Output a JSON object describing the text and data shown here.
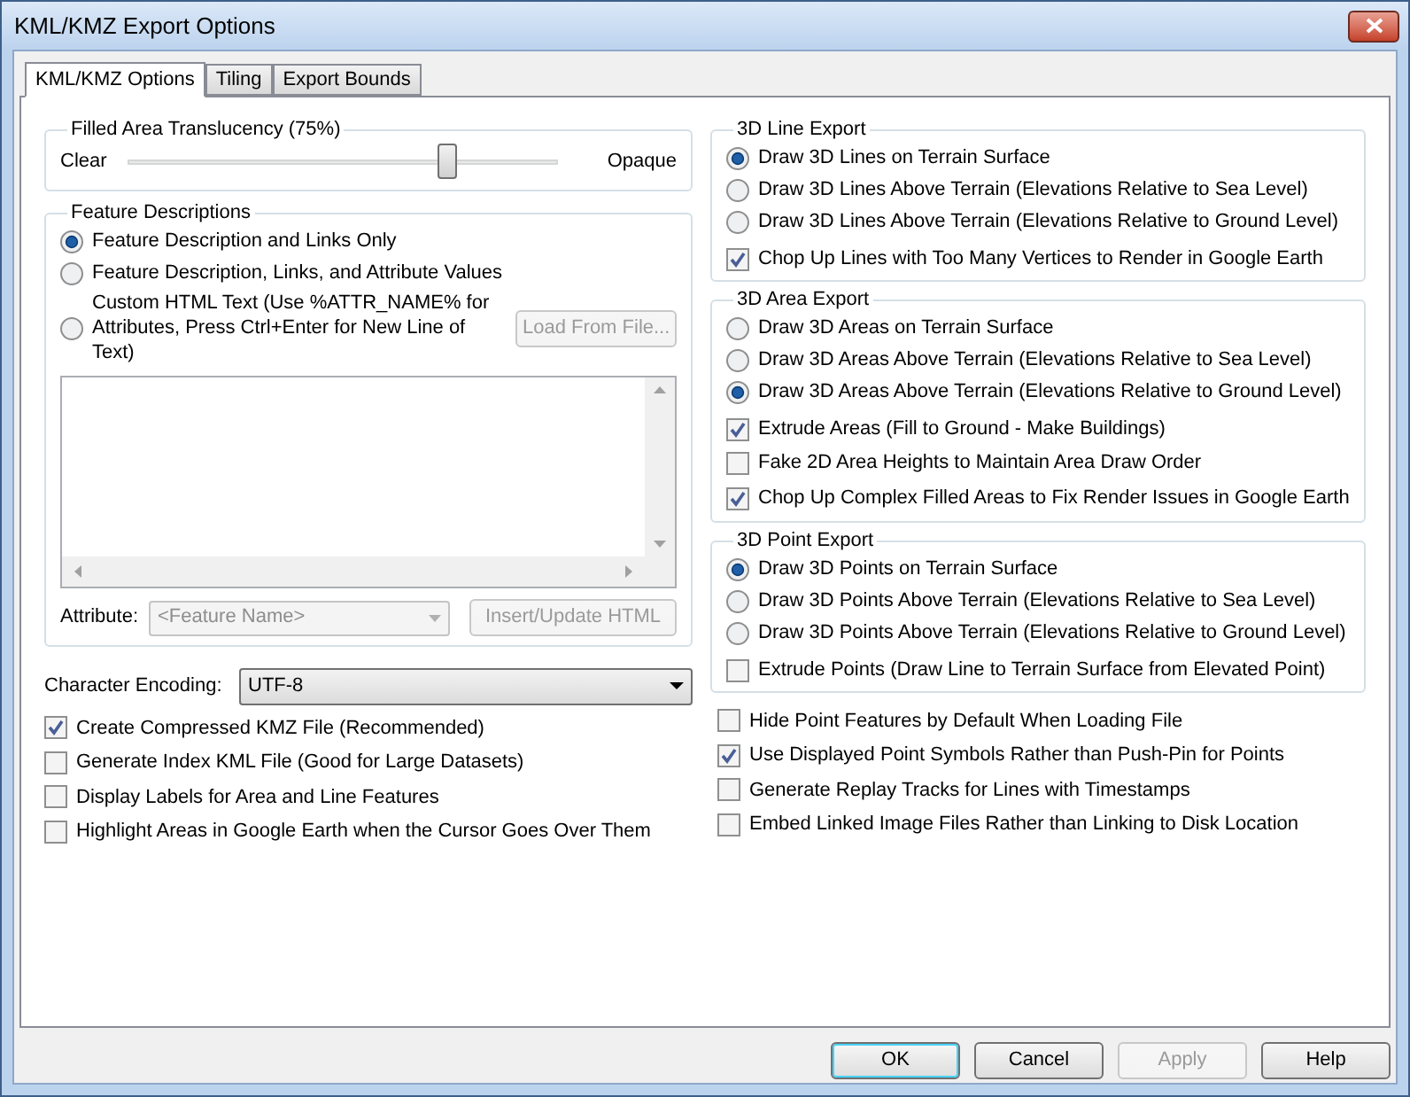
{
  "window": {
    "title": "KML/KMZ Export Options"
  },
  "tabs": [
    {
      "label": "KML/KMZ Options",
      "selected": true
    },
    {
      "label": "Tiling",
      "selected": false
    },
    {
      "label": "Export Bounds",
      "selected": false
    }
  ],
  "translucency": {
    "title": "Filled Area Translucency (75%)",
    "min_label": "Clear",
    "max_label": "Opaque",
    "level": 0.74
  },
  "feature_descriptions": {
    "title": "Feature Descriptions",
    "options": [
      {
        "label": "Feature Description and Links Only",
        "selected": true
      },
      {
        "label": "Feature Description, Links, and Attribute Values",
        "selected": false
      },
      {
        "label": "Custom HTML Text (Use %ATTR_NAME% for Attributes, Press Ctrl+Enter for New Line of Text)",
        "selected": false
      }
    ],
    "load_button": {
      "label": "Load From File...",
      "disabled": true
    },
    "attribute_label": "Attribute:",
    "attribute_select": {
      "value": "<Feature Name>",
      "disabled": true
    },
    "insert_button": {
      "label": "Insert/Update HTML",
      "disabled": true
    }
  },
  "character_encoding": {
    "label": "Character Encoding:",
    "value": "UTF-8"
  },
  "left_options": [
    {
      "label": "Create Compressed KMZ File (Recommended)",
      "checked": true
    },
    {
      "label": "Generate Index KML File (Good for Large Datasets)",
      "checked": false
    },
    {
      "label": "Display Labels for Area and Line Features",
      "checked": false
    },
    {
      "label": "Highlight Areas in Google Earth when the Cursor Goes Over Them",
      "checked": false
    }
  ],
  "groups": [
    {
      "title": "3D Line Export",
      "items": [
        {
          "kind": "radio",
          "label": "Draw 3D Lines on Terrain Surface",
          "selected": true
        },
        {
          "kind": "radio",
          "label": "Draw 3D Lines Above Terrain (Elevations Relative to Sea Level)",
          "selected": false
        },
        {
          "kind": "radio",
          "label": "Draw 3D Lines Above Terrain (Elevations Relative to Ground Level)",
          "selected": false
        },
        {
          "kind": "checkbox",
          "label": "Chop Up Lines with Too Many Vertices to Render in Google Earth",
          "checked": true
        }
      ]
    },
    {
      "title": "3D Area Export",
      "items": [
        {
          "kind": "radio",
          "label": "Draw 3D Areas on Terrain Surface",
          "selected": false
        },
        {
          "kind": "radio",
          "label": "Draw 3D Areas Above Terrain (Elevations Relative to Sea Level)",
          "selected": false
        },
        {
          "kind": "radio",
          "label": "Draw 3D Areas Above Terrain (Elevations Relative to Ground Level)",
          "selected": true
        },
        {
          "kind": "checkbox",
          "label": "Extrude Areas (Fill to Ground - Make Buildings)",
          "checked": true
        },
        {
          "kind": "checkbox",
          "label": "Fake 2D Area Heights to Maintain Area Draw Order",
          "checked": false
        },
        {
          "kind": "checkbox",
          "label": "Chop Up Complex Filled Areas to Fix Render Issues in Google Earth",
          "checked": true
        }
      ]
    },
    {
      "title": "3D Point Export",
      "items": [
        {
          "kind": "radio",
          "label": "Draw 3D Points on Terrain Surface",
          "selected": true
        },
        {
          "kind": "radio",
          "label": "Draw 3D Points Above Terrain (Elevations Relative to Sea Level)",
          "selected": false
        },
        {
          "kind": "radio",
          "label": "Draw 3D Points Above Terrain (Elevations Relative to Ground Level)",
          "selected": false
        },
        {
          "kind": "checkbox",
          "label": "Extrude Points (Draw Line to Terrain Surface from Elevated Point)",
          "checked": false
        }
      ]
    }
  ],
  "right_options": [
    {
      "label": "Hide Point Features by Default When Loading File",
      "checked": false
    },
    {
      "label": "Use Displayed Point Symbols Rather than Push-Pin for Points",
      "checked": true
    },
    {
      "label": "Generate Replay Tracks for Lines with Timestamps",
      "checked": false
    },
    {
      "label": "Embed Linked Image Files Rather than Linking to Disk Location",
      "checked": false
    }
  ],
  "buttons": [
    {
      "label": "OK",
      "default": true,
      "disabled": false
    },
    {
      "label": "Cancel",
      "default": false,
      "disabled": false
    },
    {
      "label": "Apply",
      "default": false,
      "disabled": true
    },
    {
      "label": "Help",
      "default": false,
      "disabled": false
    }
  ]
}
